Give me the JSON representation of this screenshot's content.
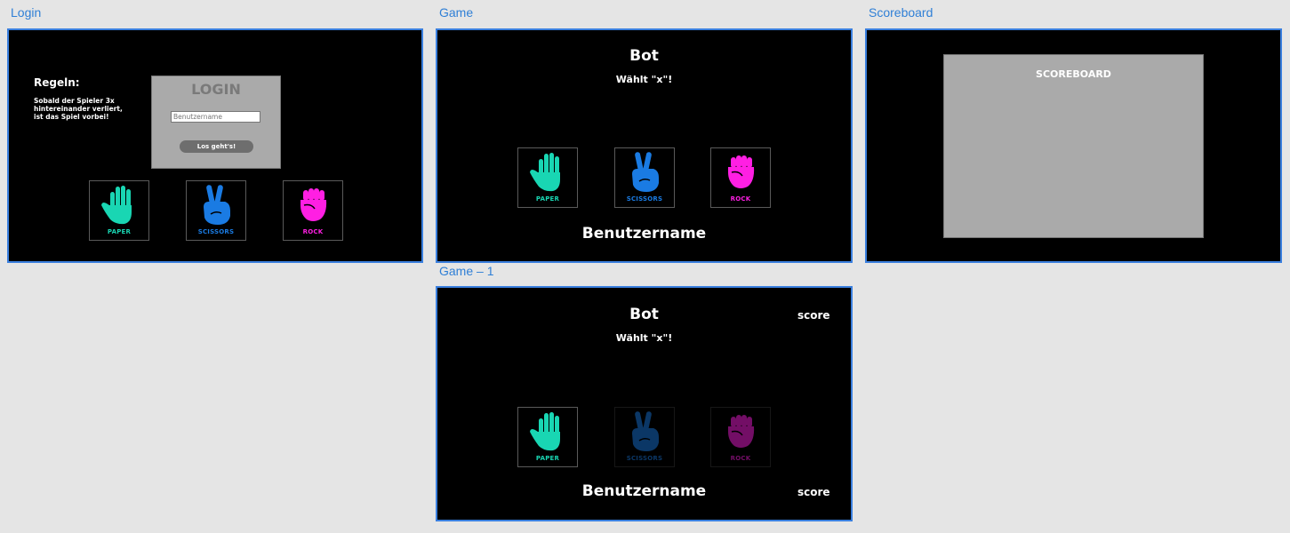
{
  "artboards": {
    "login": {
      "label": "Login"
    },
    "game": {
      "label": "Game"
    },
    "scoreboard": {
      "label": "Scoreboard"
    },
    "game1": {
      "label": "Game – 1"
    }
  },
  "login": {
    "rules_title": "Regeln:",
    "rules_text": "Sobald der Spieler 3x hintereinander verliert, ist das Spiel vorbei!",
    "panel_title": "LOGIN",
    "username_placeholder": "Benutzername",
    "submit_label": "Los geht's!"
  },
  "hands": {
    "paper": {
      "label": "PAPER",
      "color": "#19d6b3"
    },
    "scissors": {
      "label": "SCISSORS",
      "color": "#1a7be3"
    },
    "rock": {
      "label": "ROCK",
      "color": "#ff1fe3"
    }
  },
  "game": {
    "bot_title": "Bot",
    "bot_choice": "Wählt \"x\"!",
    "username": "Benutzername",
    "score_label": "score"
  },
  "scoreboard": {
    "title": "SCOREBOARD"
  }
}
